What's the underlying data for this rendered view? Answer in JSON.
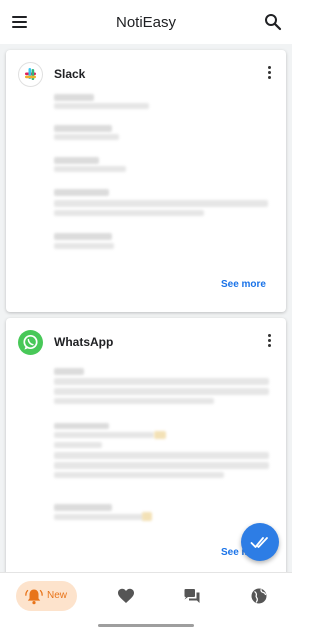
{
  "app": {
    "title": "NotiEasy"
  },
  "icons": {
    "menu": "menu-icon",
    "search": "search-icon",
    "more": "more-vert-icon",
    "mark_all_read": "double-check-icon",
    "bell": "bell-icon",
    "favorites": "heart-icon",
    "chats": "chat-icon",
    "web": "globe-icon"
  },
  "colors": {
    "accent": "#1a73e8",
    "fab": "#2d7de5",
    "nav_active_bg": "#fde3cc",
    "nav_active_fg": "#e8741a",
    "whatsapp": "#48c858"
  },
  "notifications": [
    {
      "app_name": "Slack",
      "action": "See more"
    },
    {
      "app_name": "WhatsApp",
      "action": "See more"
    }
  ],
  "bottom_nav": {
    "new_label": "New"
  }
}
